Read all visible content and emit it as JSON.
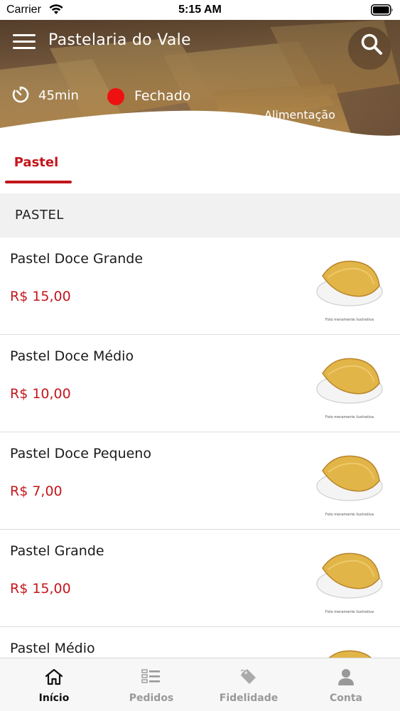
{
  "status_bar": {
    "carrier": "Carrier",
    "time": "5:15 AM"
  },
  "header": {
    "title": "Pastelaria do Vale",
    "delivery_time": "45min",
    "status": "Fechado",
    "status_color": "#ee1111",
    "category": "Alimentação"
  },
  "tabs": [
    {
      "label": "Pastel",
      "active": true
    }
  ],
  "section": {
    "title": "PASTEL"
  },
  "products": [
    {
      "name": "Pastel Doce Grande",
      "price": "R$ 15,00",
      "image_caption": "Foto meramente ilustrativa"
    },
    {
      "name": "Pastel Doce Médio",
      "price": "R$ 10,00",
      "image_caption": "Foto meramente ilustrativa"
    },
    {
      "name": "Pastel Doce Pequeno",
      "price": "R$ 7,00",
      "image_caption": "Foto meramente ilustrativa"
    },
    {
      "name": "Pastel Grande",
      "price": "R$ 15,00",
      "image_caption": "Foto meramente ilustrativa"
    },
    {
      "name": "Pastel Médio",
      "price": "",
      "image_caption": ""
    }
  ],
  "tabbar": [
    {
      "label": "Início",
      "icon": "home-icon",
      "active": true
    },
    {
      "label": "Pedidos",
      "icon": "orders-list-icon",
      "active": false
    },
    {
      "label": "Fidelidade",
      "icon": "loyalty-tag-icon",
      "active": false
    },
    {
      "label": "Conta",
      "icon": "user-icon",
      "active": false
    }
  ],
  "colors": {
    "accent": "#c4161c",
    "status_closed": "#ee1111"
  }
}
